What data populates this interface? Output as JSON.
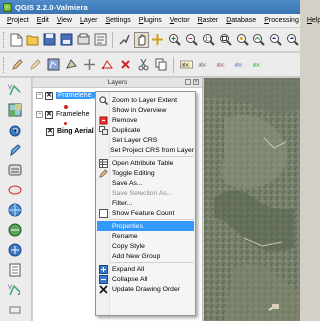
{
  "window": {
    "title": "QGIS 2.2.0-Valmiera"
  },
  "menubar": [
    {
      "label": "Project",
      "u": "P"
    },
    {
      "label": "Edit",
      "u": "E"
    },
    {
      "label": "View",
      "u": "V"
    },
    {
      "label": "Layer",
      "u": "L"
    },
    {
      "label": "Settings",
      "u": "S"
    },
    {
      "label": "Plugins",
      "u": "P"
    },
    {
      "label": "Vector",
      "u": "V"
    },
    {
      "label": "Raster",
      "u": "R"
    },
    {
      "label": "Database",
      "u": "D"
    },
    {
      "label": "Processing",
      "u": "P"
    },
    {
      "label": "Help",
      "u": "H"
    }
  ],
  "layers_panel": {
    "title": "Layers",
    "layers": [
      {
        "name": "Framelehe_Polz",
        "checked": true,
        "selected": true
      },
      {
        "name": "Framelehe",
        "checked": true,
        "selected": false
      },
      {
        "name": "Bing Aerial",
        "checked": true,
        "selected": false
      }
    ]
  },
  "context_menu": {
    "items": [
      {
        "label": "Zoom to Layer Extent",
        "icon": "zoom-extent-icon",
        "disabled": false
      },
      {
        "label": "Show in Overview",
        "icon": "",
        "disabled": false
      },
      {
        "label": "Remove",
        "icon": "remove-icon",
        "disabled": false
      },
      {
        "label": "Duplicate",
        "icon": "duplicate-icon",
        "disabled": false
      },
      {
        "label": "Set Layer CRS",
        "icon": "",
        "disabled": false
      },
      {
        "label": "Set Project CRS from Layer",
        "icon": "",
        "disabled": false
      },
      {
        "sep": true
      },
      {
        "label": "Open Attribute Table",
        "icon": "attribute-table-icon",
        "disabled": false
      },
      {
        "label": "Toggle Editing",
        "icon": "pencil-icon",
        "disabled": false
      },
      {
        "label": "Save As...",
        "icon": "",
        "disabled": false
      },
      {
        "label": "Save Selection As...",
        "icon": "",
        "disabled": true
      },
      {
        "label": "Filter...",
        "icon": "",
        "disabled": false
      },
      {
        "label": "Show Feature Count",
        "icon": "checkbox-icon",
        "disabled": false
      },
      {
        "sep": true
      },
      {
        "label": "Properties",
        "icon": "",
        "disabled": false,
        "highlight": true
      },
      {
        "label": "Rename",
        "icon": "",
        "disabled": false
      },
      {
        "label": "Copy Style",
        "icon": "",
        "disabled": false
      },
      {
        "label": "Add New Group",
        "icon": "",
        "disabled": false
      },
      {
        "sep": true
      },
      {
        "label": "Expand All",
        "icon": "expand-all-icon",
        "disabled": false
      },
      {
        "label": "Collapse All",
        "icon": "collapse-all-icon",
        "disabled": false
      },
      {
        "label": "Update Drawing Order",
        "icon": "update-order-icon",
        "disabled": false
      }
    ]
  },
  "colors": {
    "highlight": "#3399ff",
    "title_bar": "#3a74b3",
    "feature": "#d42525"
  }
}
